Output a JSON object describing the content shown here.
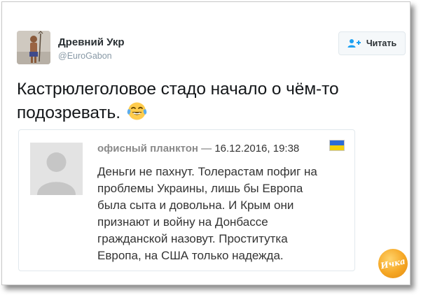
{
  "tweet": {
    "display_name": "Древний Укр",
    "handle": "@EuroGabon",
    "follow_label": "Читать",
    "text": "Кастрюлеголовое стадо начало о чём-то подозревать.",
    "emoji": "face-with-tears-of-joy"
  },
  "quote": {
    "author": "офисный планктон",
    "separator": "—",
    "date": "16.12.2016, 19:38",
    "flag_colors": [
      "#2d6cd6",
      "#f5d10a"
    ],
    "text": "Деньги не пахнут. Толерастам пофиг на\nпроблемы Украины, лишь бы Европа\nбыла сыта и довольна. И Крым они\nпризнают и войну на Донбассе\nгражданской назовут. Проститутка\nЕвропа, на США только надежда."
  },
  "watermark": {
    "text": "Ичка",
    "color": "#f5a623"
  },
  "colors": {
    "follow_icon": "#1da1f2",
    "handle": "#8899a6"
  }
}
